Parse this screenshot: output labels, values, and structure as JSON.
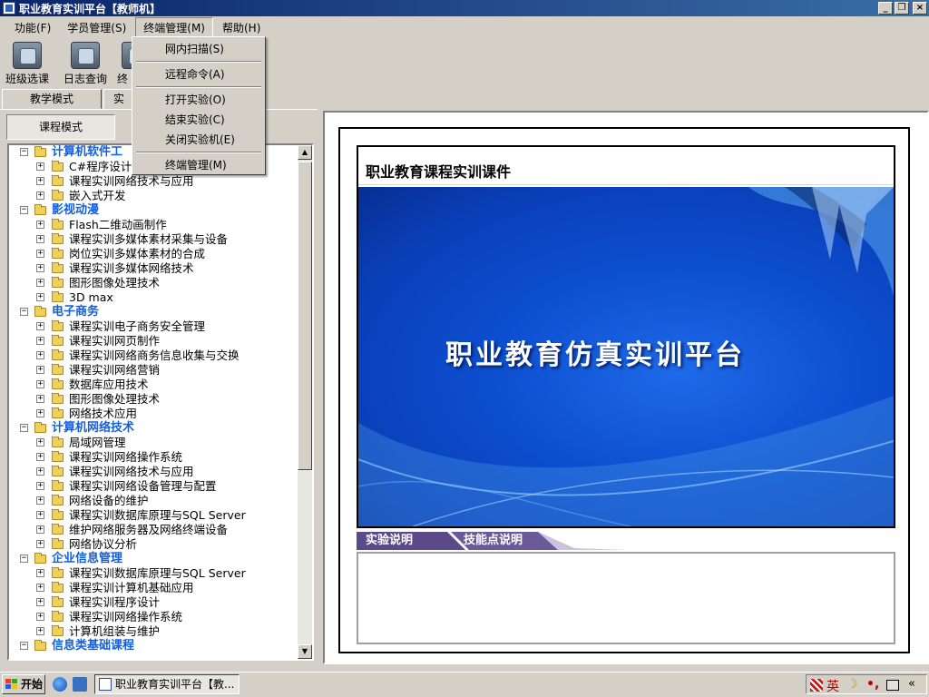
{
  "window": {
    "title": "职业教育实训平台【教师机】",
    "buttons": {
      "minimize": "_",
      "restore": "❐",
      "close": "×"
    }
  },
  "menubar": [
    {
      "label": "功能(F)"
    },
    {
      "label": "学员管理(S)"
    },
    {
      "label": "终端管理(M)"
    },
    {
      "label": "帮助(H)"
    }
  ],
  "dropdown": {
    "items": [
      "网内扫描(S)",
      "远程命令(A)",
      "打开实验(O)",
      "结束实验(C)",
      "关闭实验机(E)",
      "终端管理(M)"
    ]
  },
  "toolbar": {
    "buttons": [
      {
        "label": "班级选课"
      },
      {
        "label": "日志查询"
      },
      {
        "label": "终"
      }
    ]
  },
  "tabs": [
    {
      "label": "教学模式"
    },
    {
      "label": "实"
    }
  ],
  "mode_button": "课程模式",
  "tree": {
    "categories": [
      {
        "name": "计算机软件工",
        "items": [
          "C#程序设计",
          "课程实训网络技术与应用",
          "嵌入式开发"
        ]
      },
      {
        "name": "影视动漫",
        "items": [
          "Flash二维动画制作",
          "课程实训多媒体素材采集与设备",
          "岗位实训多媒体素材的合成",
          "课程实训多媒体网络技术",
          "图形图像处理技术",
          "3D max"
        ]
      },
      {
        "name": "电子商务",
        "items": [
          "课程实训电子商务安全管理",
          "课程实训网页制作",
          "课程实训网络商务信息收集与交换",
          "课程实训网络营销",
          "数据库应用技术",
          "图形图像处理技术",
          "网络技术应用"
        ]
      },
      {
        "name": "计算机网络技术",
        "items": [
          "局域网管理",
          "课程实训网络操作系统",
          "课程实训网络技术与应用",
          "课程实训网络设备管理与配置",
          "网络设备的维护",
          "课程实训数据库原理与SQL Server",
          "维护网络服务器及网络终端设备",
          "网络协议分析"
        ]
      },
      {
        "name": "企业信息管理",
        "items": [
          "课程实训数据库原理与SQL Server",
          "课程实训计算机基础应用",
          "课程实训程序设计",
          "课程实训网络操作系统",
          "计算机组装与维护"
        ]
      },
      {
        "name": "信息类基础课程",
        "items": []
      }
    ]
  },
  "scrollbar": {
    "up": "▲",
    "down": "▼"
  },
  "slide": {
    "header_title": "职业教育课程实训课件",
    "banner_title": "职业教育仿真实训平台"
  },
  "info_tabs": [
    {
      "label": "实验说明"
    },
    {
      "label": "技能点说明"
    }
  ],
  "taskbar": {
    "start_label": "开始",
    "task_label": "职业教育实训平台【教...",
    "tray": {
      "lang": "英",
      "moon": "☽",
      "dots": "•,",
      "collapse": "«"
    }
  },
  "colors": {
    "title_bar": "#0a246a",
    "tree_category": "#1060e0",
    "slide_blue": "#0d4fd0",
    "info_tab": "#5a4a8a"
  }
}
